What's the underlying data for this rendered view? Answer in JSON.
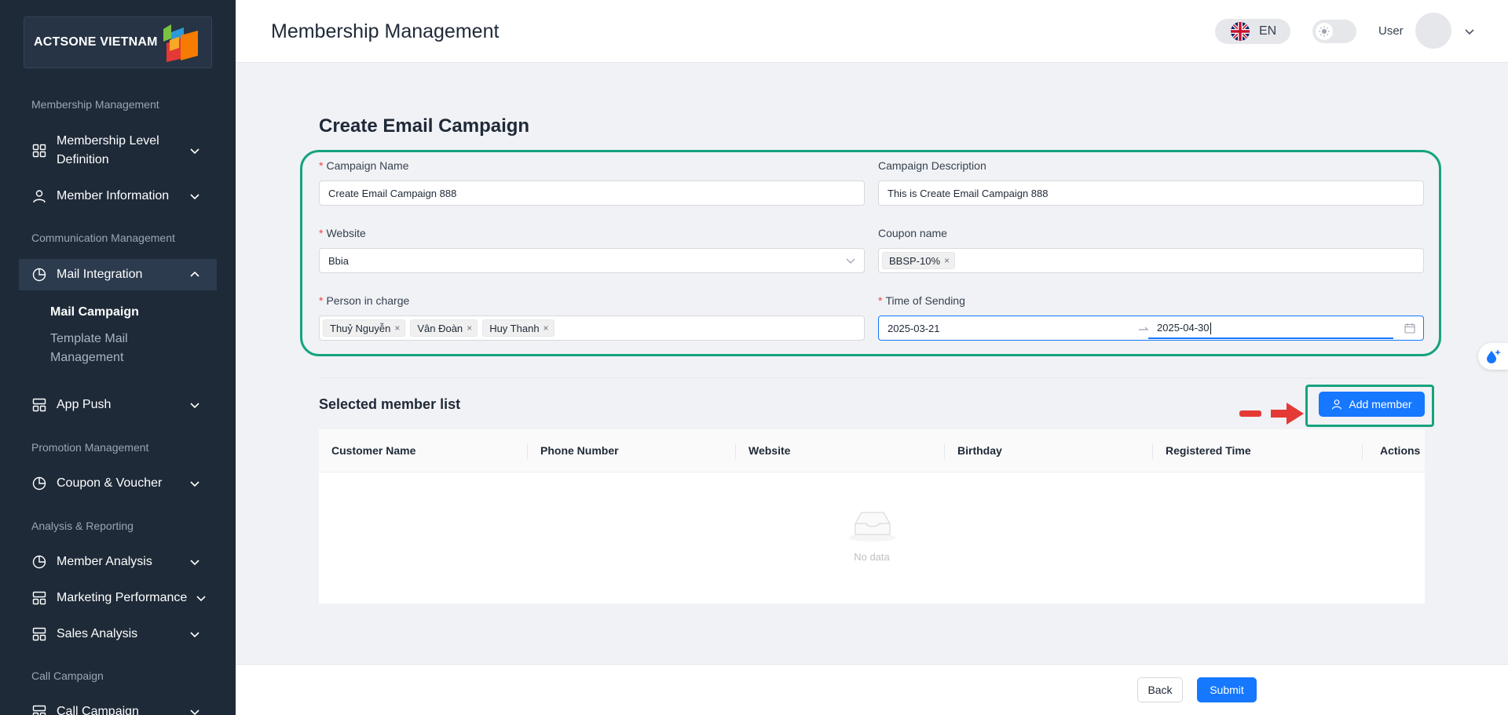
{
  "brand": {
    "name": "ACTSONE VIETNAM"
  },
  "header": {
    "title": "Membership Management",
    "language": "EN",
    "user_label": "User",
    "flag_icon": "uk-flag-icon",
    "theme_icon": "sun-icon"
  },
  "sidebar": {
    "sections": [
      "Membership Management",
      "Communication Management",
      "Promotion Management",
      "Analysis & Reporting",
      "Call Campaign"
    ],
    "items": [
      {
        "label": "Membership Level Definition",
        "icon": "grid-icon",
        "expanded": false
      },
      {
        "label": "Member Information",
        "icon": "user-icon",
        "expanded": false
      },
      {
        "label": "Mail Integration",
        "icon": "pie-chart-icon",
        "expanded": true,
        "active": true
      },
      {
        "label": "App Push",
        "icon": "layout-icon",
        "expanded": false
      },
      {
        "label": "Coupon & Voucher",
        "icon": "pie-chart-icon",
        "expanded": false
      },
      {
        "label": "Member Analysis",
        "icon": "pie-chart-icon",
        "expanded": false
      },
      {
        "label": "Marketing Performance",
        "icon": "layout-icon",
        "expanded": false
      },
      {
        "label": "Sales Analysis",
        "icon": "layout-icon",
        "expanded": false
      },
      {
        "label": "Call Campaign",
        "icon": "layout-icon",
        "expanded": false
      }
    ],
    "sub_items": [
      {
        "label": "Mail Campaign",
        "active": true
      },
      {
        "label": "Template Mail Management",
        "active": false
      }
    ]
  },
  "form": {
    "title": "Create Email Campaign",
    "campaign_name": {
      "label": "Campaign Name",
      "required": true,
      "value": "Create Email Campaign 888"
    },
    "campaign_description": {
      "label": "Campaign Description",
      "required": false,
      "value": "This is Create Email Campaign 888"
    },
    "website": {
      "label": "Website",
      "required": true,
      "value": "Bbia"
    },
    "coupon_name": {
      "label": "Coupon name",
      "required": false,
      "tags": [
        "BBSP-10%"
      ]
    },
    "person_in_charge": {
      "label": "Person in charge",
      "required": true,
      "tags": [
        "Thuỷ Nguyễn",
        "Vân Đoàn",
        "Huy Thanh"
      ]
    },
    "time_of_sending": {
      "label": "Time of Sending",
      "required": true,
      "start": "2025-03-21",
      "end": "2025-04-30"
    }
  },
  "member_list": {
    "title": "Selected member list",
    "add_button": "Add member",
    "columns": [
      "Customer Name",
      "Phone Number",
      "Website",
      "Birthday",
      "Registered Time",
      "Actions"
    ],
    "rows": [],
    "empty_text": "No data"
  },
  "footer": {
    "back_label": "Back",
    "submit_label": "Submit"
  },
  "colors": {
    "sidebar_bg": "#1e2a38",
    "primary": "#1677ff",
    "highlight": "#16a37f",
    "annotation_arrow": "#e53935",
    "required": "#ef4444"
  }
}
